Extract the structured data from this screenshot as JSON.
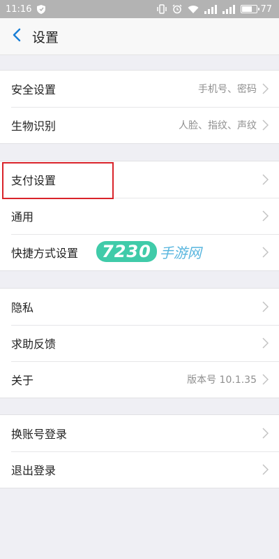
{
  "status_bar": {
    "time": "11:16",
    "battery": "77",
    "battery_level": 0.77,
    "icons": [
      "shield-icon",
      "vibrate-icon",
      "alarm-icon",
      "wifi-icon",
      "signal-4g-icon",
      "signal-icon",
      "battery-icon"
    ]
  },
  "header": {
    "back_icon": "chevron-left-icon",
    "title": "设置"
  },
  "groups": [
    [
      {
        "label": "安全设置",
        "value": "手机号、密码"
      },
      {
        "label": "生物识别",
        "value": "人脸、指纹、声纹"
      }
    ],
    [
      {
        "label": "支付设置",
        "value": ""
      },
      {
        "label": "通用",
        "value": ""
      },
      {
        "label": "快捷方式设置",
        "value": ""
      }
    ],
    [
      {
        "label": "隐私",
        "value": ""
      },
      {
        "label": "求助反馈",
        "value": ""
      },
      {
        "label": "关于",
        "value": "版本号 10.1.35"
      }
    ],
    [
      {
        "label": "换账号登录",
        "value": ""
      },
      {
        "label": "退出登录",
        "value": ""
      }
    ]
  ],
  "watermark": {
    "number": "7230",
    "text": "手游网"
  },
  "colors": {
    "accent": "#1a7fd6",
    "highlight": "#d9232a",
    "background": "#efeff4"
  }
}
